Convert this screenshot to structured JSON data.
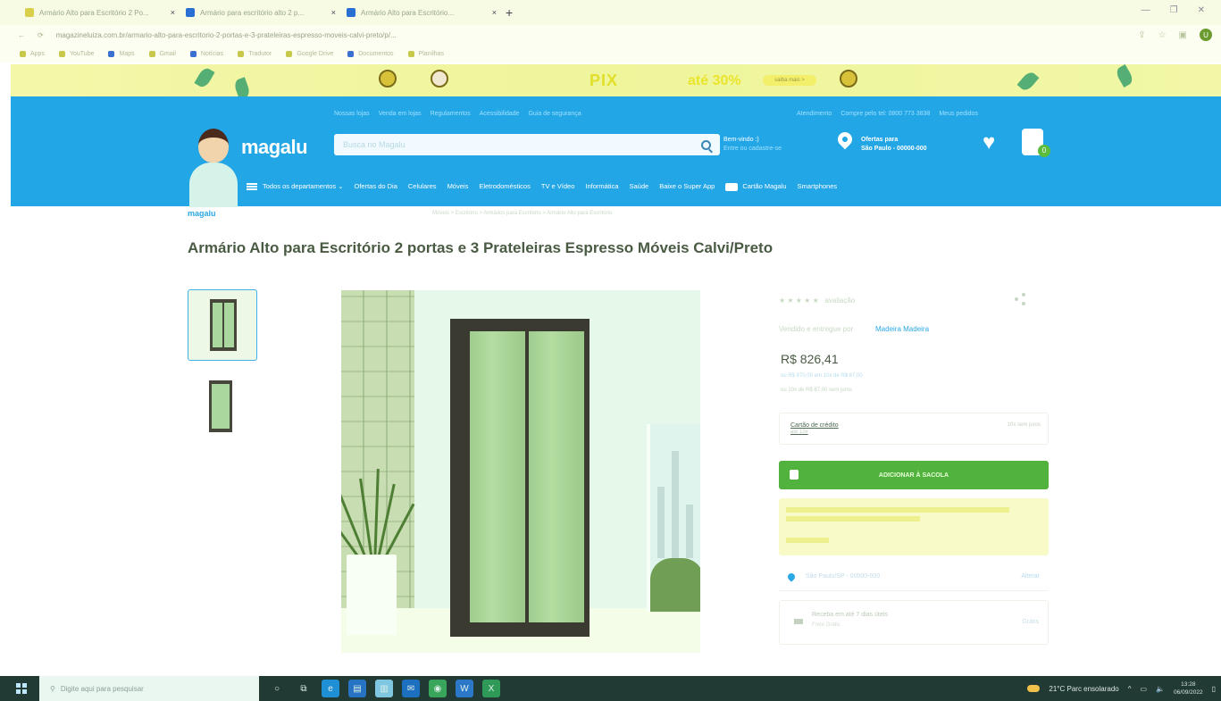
{
  "browser": {
    "tabs": [
      {
        "label": "Armário Alto para Escritório 2 Po..."
      },
      {
        "label": "Armário para escritório alto 2 p..."
      },
      {
        "label": "Armário Alto para Escritório..."
      }
    ],
    "url": "magazineluiza.com.br/armario-alto-para-escritorio-2-portas-e-3-prateleiras-espresso-moveis-calvi-preto/p/...",
    "bookmarks": [
      "Apps",
      "YouTube",
      "Maps",
      "Gmail",
      "Notícias",
      "Tradutor",
      "Google Drive",
      "Documentos",
      "Planilhas"
    ],
    "profile_initial": "U"
  },
  "banner": {
    "pix": "PIX",
    "pct": "até 30%",
    "cta": "saiba mais >"
  },
  "header": {
    "top_links": [
      "Nossas lojas",
      "Venda em lojas",
      "Regulamentos",
      "Acessibilidade",
      "Guia de segurança"
    ],
    "top_links_right": [
      "Atendimento",
      "Compre pelo tel: 0800 773 3838",
      "Meus pedidos"
    ],
    "logo": "magalu",
    "search_placeholder": "Busca no Magalu",
    "greeting": "Bem-vindo :)",
    "greeting_sub": "Entre ou cadastre-se",
    "location_label": "Ofertas para",
    "location_value": "São Paulo - 00000-000",
    "cart_count": "0",
    "nav_items": [
      "Todos os departamentos",
      "Ofertas do Dia",
      "Celulares",
      "Móveis",
      "Eletrodomésticos",
      "TV e Vídeo",
      "Informática",
      "Saúde",
      "Baixe o Super App",
      "Cartão Magalu",
      "Smartphones"
    ]
  },
  "breadcrumb": {
    "logo": "magalu",
    "path": "Móveis > Escritório > Armários para Escritório > Armário Alto para Escritório"
  },
  "product": {
    "title": "Armário Alto para Escritório 2 portas e 3 Prateleiras Espresso Móveis Calvi/Preto",
    "rating_text": "avaliação",
    "seller_prefix": "Vendido e entregue por",
    "seller": "Madeira Madeira",
    "price": "R$ 826,41",
    "price_line1": "ou R$ 870,00 em 10x de R$ 87,00",
    "price_line2": "ou 10x de R$ 87,00 sem juros",
    "card_label": "Cartão de crédito",
    "card_sub": "até 10x",
    "card_right": "10x sem juros",
    "add_button": "ADICIONAR À SACOLA",
    "cep_text": "São Paulo/SP - 00000-000",
    "cep_action": "Alterar",
    "ship_title": "Receba em até 7 dias úteis",
    "ship_sub": "Frete Grátis",
    "ship_value": "Grátis"
  },
  "taskbar": {
    "search_placeholder": "Digite aqui para pesquisar",
    "weather": "21°C Parc ensolarado",
    "time": "13:28",
    "date": "06/09/2022"
  },
  "colors": {
    "header_blue": "#23a6e6",
    "buy_green": "#52b23e",
    "banner_yellow": "#f4f7a8"
  }
}
